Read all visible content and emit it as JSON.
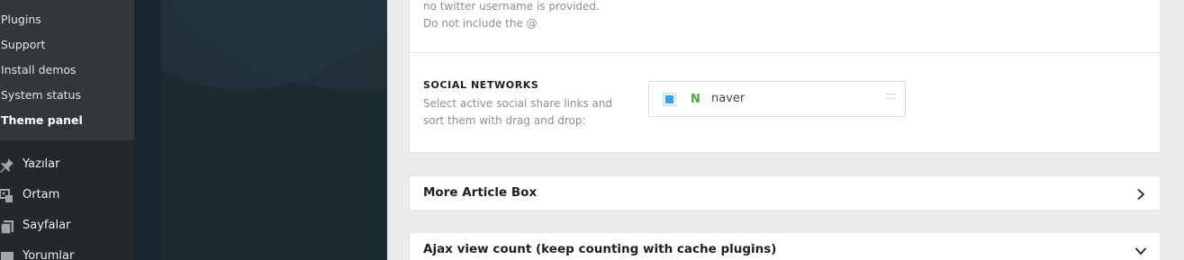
{
  "sidebar": {
    "submenu": [
      "Plugins",
      "Support",
      "Install demos",
      "System status",
      "Theme panel"
    ],
    "current": "Theme panel",
    "menu": [
      {
        "label": "Yazılar",
        "icon": "pin-icon"
      },
      {
        "label": "Ortam",
        "icon": "media-icon"
      },
      {
        "label": "Sayfalar",
        "icon": "pages-icon"
      },
      {
        "label": "Yorumlar",
        "icon": "comments-icon"
      }
    ]
  },
  "panel": {
    "twitter_desc_line1": "no twitter username is provided.",
    "twitter_desc_line2": "Do not include the @",
    "social": {
      "title": "SOCIAL NETWORKS",
      "description": "Select active social share links and sort them with drag and drop:",
      "items": [
        {
          "label": "naver",
          "icon": "naver-icon",
          "checked": true
        }
      ]
    },
    "sections": [
      {
        "title": "More Article Box",
        "state": "collapsed",
        "icon": "chevron-right-icon"
      },
      {
        "title": "Ajax view count (keep counting with cache plugins)",
        "state": "expanded",
        "icon": "chevron-down-icon"
      }
    ]
  },
  "colors": {
    "sidebar": "#23282d",
    "submenu": "#32373c",
    "backdrop": "#1e2e36",
    "accent": "#37a3e0",
    "naver": "#3cb134"
  }
}
